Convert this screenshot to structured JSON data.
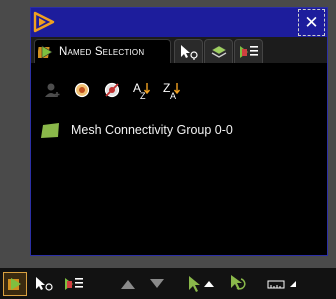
{
  "panel": {
    "close_glyph": "✕",
    "tabs": [
      {
        "label": "Named Selection",
        "icon": "named-selection-icon",
        "active": true
      },
      {
        "label": "",
        "icon": "pick-cursor-icon",
        "active": false
      },
      {
        "label": "",
        "icon": "layers-icon",
        "active": false
      },
      {
        "label": "",
        "icon": "selection-list-icon",
        "active": false
      }
    ],
    "toolbar": {
      "sort_az_label": "AZ",
      "sort_za_label": "ZA"
    },
    "items": [
      {
        "label": "Mesh Connectivity Group 0-0",
        "color": "#8ab84a"
      }
    ]
  },
  "colors": {
    "title_bar": "#1d1d9c",
    "panel_bg": "#000000",
    "accent_orange": "#f0a020",
    "group_green": "#8ab84a"
  }
}
